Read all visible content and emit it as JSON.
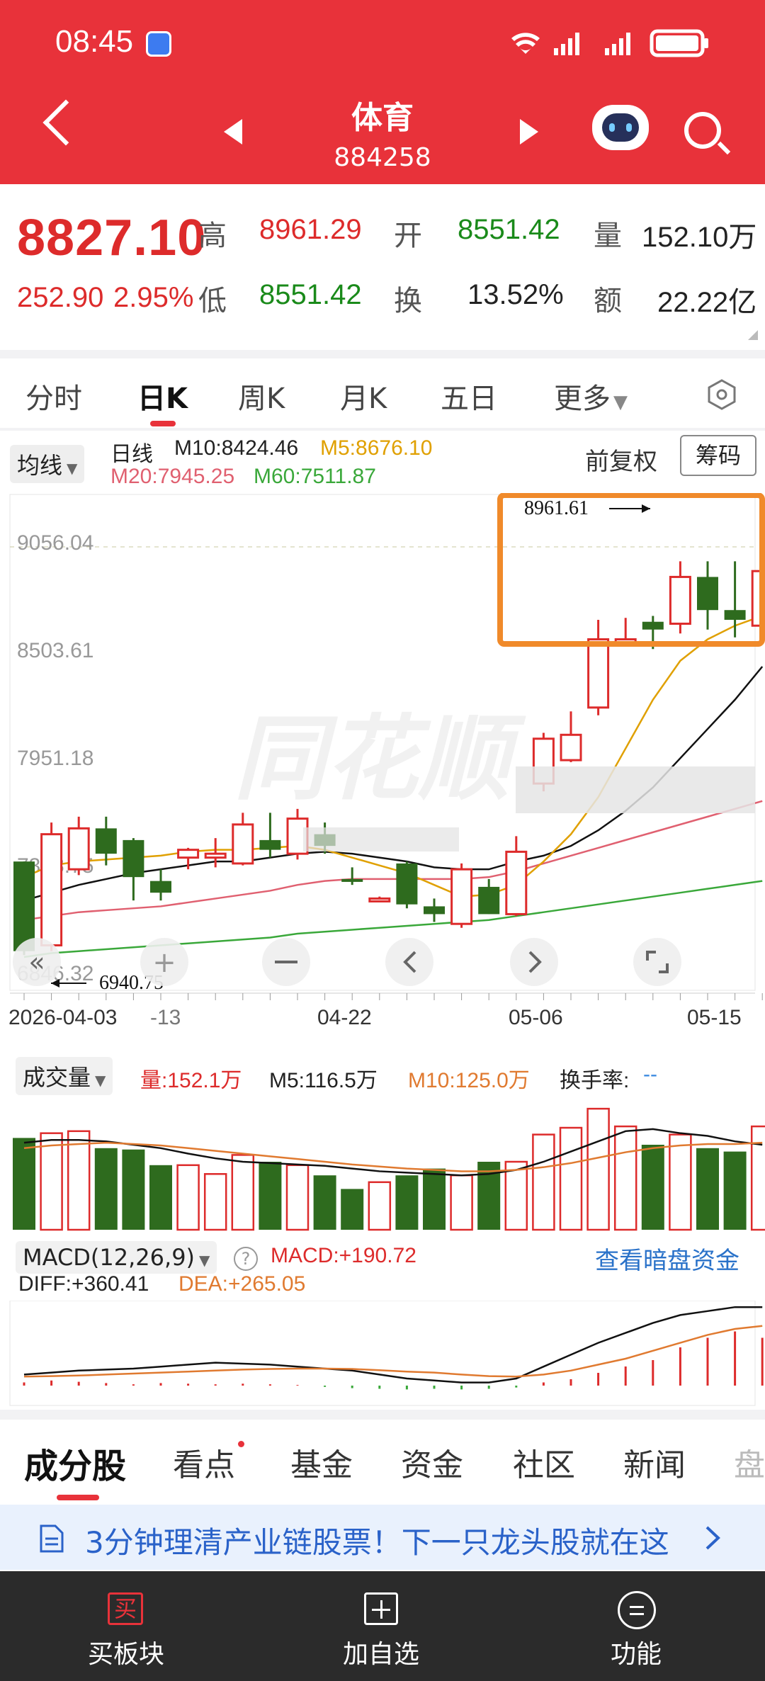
{
  "status_bar": {
    "time": "08:45"
  },
  "header": {
    "title": "体育",
    "code": "884258"
  },
  "quote": {
    "price": "8827.10",
    "change": "252.90",
    "change_pct": "2.95%",
    "high_label": "高",
    "high": "8961.29",
    "open_label": "开",
    "open": "8551.42",
    "volume_label": "量",
    "volume": "152.10万",
    "low_label": "低",
    "low": "8551.42",
    "turnover_label": "换",
    "turnover": "13.52%",
    "amount_label": "额",
    "amount": "22.22亿"
  },
  "period_tabs": [
    "分时",
    "日K",
    "周K",
    "月K",
    "五日",
    "更多"
  ],
  "indicator": {
    "ma_select": "均线",
    "period": "日线",
    "m10": "M10:8424.46",
    "m5": "M5:8676.10",
    "m20": "M20:7945.25",
    "m60": "M60:7511.87",
    "adjust": "前复权",
    "chips": "筹码"
  },
  "kline_axis": {
    "y_labels": [
      "9056.04",
      "8503.61",
      "7951.18",
      "7398.75",
      "6846.32"
    ],
    "x_labels": [
      "2026-04-03",
      "-13",
      "04-22",
      "05-06",
      "05-15"
    ],
    "high_marker": "8961.61",
    "low_marker": "6940.75"
  },
  "volume_panel": {
    "select": "成交量",
    "vol": "量:152.1万",
    "m5": "M5:116.5万",
    "m10": "M10:125.0万",
    "turnover": "换手率:",
    "turnover_val": "--"
  },
  "macd_panel": {
    "select": "MACD(12,26,9)",
    "macd": "MACD:+190.72",
    "link": "查看暗盘资金",
    "diff": "DIFF:+360.41",
    "dea": "DEA:+265.05"
  },
  "bottom_tabs": [
    "成分股",
    "看点",
    "基金",
    "资金",
    "社区",
    "新闻",
    "盘"
  ],
  "banner": {
    "text": "3分钟理清产业链股票！下一只龙头股就在这"
  },
  "nav": {
    "buy": "买板块",
    "buy_icon": "买",
    "add": "加自选",
    "func": "功能"
  },
  "colors": {
    "up": "#dd2b2b",
    "down": "#2e6b1e",
    "brand": "#e8323a",
    "highlight": "#f08a2a"
  },
  "chart_data": {
    "type": "candlestick",
    "y_range": [
      6846.32,
      9056.04
    ],
    "candles": [
      {
        "o": 7420,
        "c": 6960,
        "h": 7420,
        "l": 6940
      },
      {
        "o": 6990,
        "c": 7560,
        "h": 7620,
        "l": 6960
      },
      {
        "o": 7380,
        "c": 7590,
        "h": 7650,
        "l": 7350
      },
      {
        "o": 7590,
        "c": 7460,
        "h": 7650,
        "l": 7400
      },
      {
        "o": 7530,
        "c": 7340,
        "h": 7540,
        "l": 7220
      },
      {
        "o": 7320,
        "c": 7260,
        "h": 7380,
        "l": 7220
      },
      {
        "o": 7440,
        "c": 7480,
        "h": 7490,
        "l": 7380
      },
      {
        "o": 7440,
        "c": 7460,
        "h": 7540,
        "l": 7390
      },
      {
        "o": 7410,
        "c": 7610,
        "h": 7670,
        "l": 7400
      },
      {
        "o": 7530,
        "c": 7480,
        "h": 7670,
        "l": 7440
      },
      {
        "o": 7460,
        "c": 7640,
        "h": 7690,
        "l": 7430
      },
      {
        "o": 7560,
        "c": 7500,
        "h": 7620,
        "l": 7460
      },
      {
        "o": 7330,
        "c": 7320,
        "h": 7390,
        "l": 7300
      },
      {
        "o": 7230,
        "c": 7230,
        "h": 7240,
        "l": 7220
      },
      {
        "o": 7410,
        "c": 7200,
        "h": 7420,
        "l": 7180
      },
      {
        "o": 7190,
        "c": 7150,
        "h": 7230,
        "l": 7110
      },
      {
        "o": 7100,
        "c": 7380,
        "h": 7410,
        "l": 7080
      },
      {
        "o": 7290,
        "c": 7150,
        "h": 7330,
        "l": 7150
      },
      {
        "o": 7150,
        "c": 7470,
        "h": 7550,
        "l": 7140
      },
      {
        "o": 7820,
        "c": 8050,
        "h": 8080,
        "l": 7780
      },
      {
        "o": 7940,
        "c": 8070,
        "h": 8190,
        "l": 7930
      },
      {
        "o": 8210,
        "c": 8560,
        "h": 8660,
        "l": 8170
      },
      {
        "o": 8560,
        "c": 8560,
        "h": 8670,
        "l": 8530
      },
      {
        "o": 8650,
        "c": 8610,
        "h": 8680,
        "l": 8510
      },
      {
        "o": 8640,
        "c": 8880,
        "h": 8960,
        "l": 8590
      },
      {
        "o": 8880,
        "c": 8710,
        "h": 8960,
        "l": 8610
      },
      {
        "o": 8710,
        "c": 8660,
        "h": 8960,
        "l": 8570
      },
      {
        "o": 8630,
        "c": 8910,
        "h": 8960,
        "l": 8630
      }
    ],
    "ma5": [
      7340,
      7400,
      7420,
      7430,
      7440,
      7450,
      7470,
      7480,
      7480,
      7490,
      7500,
      7480,
      7440,
      7400,
      7360,
      7300,
      7240,
      7250,
      7300,
      7420,
      7560,
      7750,
      8000,
      8250,
      8450,
      8560,
      8630,
      8680
    ],
    "ma10": [
      7220,
      7260,
      7300,
      7330,
      7360,
      7380,
      7400,
      7420,
      7420,
      7440,
      7460,
      7470,
      7460,
      7440,
      7420,
      7390,
      7380,
      7380,
      7420,
      7450,
      7500,
      7580,
      7680,
      7800,
      7950,
      8100,
      8250,
      8420
    ],
    "ma20": [
      7120,
      7140,
      7160,
      7170,
      7180,
      7190,
      7210,
      7230,
      7250,
      7270,
      7300,
      7320,
      7330,
      7330,
      7330,
      7330,
      7330,
      7340,
      7370,
      7410,
      7450,
      7490,
      7530,
      7570,
      7610,
      7650,
      7690,
      7730
    ],
    "ma60": [
      6930,
      6950,
      6960,
      6970,
      6980,
      6990,
      7000,
      7010,
      7020,
      7030,
      7050,
      7060,
      7070,
      7080,
      7090,
      7100,
      7110,
      7120,
      7140,
      7160,
      7180,
      7200,
      7220,
      7240,
      7260,
      7280,
      7300,
      7320
    ],
    "volume": [
      135,
      142,
      145,
      120,
      118,
      95,
      95,
      82,
      110,
      100,
      95,
      80,
      60,
      70,
      80,
      90,
      80,
      100,
      100,
      140,
      150,
      178,
      152,
      125,
      140,
      120,
      115,
      152
    ],
    "vol_m5": [
      128,
      132,
      132,
      130,
      125,
      120,
      112,
      105,
      100,
      98,
      96,
      94,
      90,
      86,
      84,
      82,
      80,
      82,
      88,
      100,
      115,
      130,
      145,
      148,
      142,
      138,
      130,
      125
    ],
    "vol_m10": [
      120,
      124,
      126,
      128,
      126,
      124,
      120,
      116,
      112,
      108,
      104,
      100,
      96,
      93,
      90,
      88,
      86,
      86,
      88,
      92,
      98,
      106,
      114,
      120,
      124,
      126,
      126,
      128
    ],
    "macd_hist": [
      5,
      8,
      6,
      4,
      2,
      4,
      3,
      2,
      3,
      2,
      1,
      -2,
      -4,
      -5,
      -6,
      -5,
      -6,
      -5,
      -3,
      5,
      10,
      20,
      30,
      40,
      60,
      75,
      85,
      75
    ],
    "diff": [
      20,
      30,
      40,
      45,
      50,
      60,
      70,
      80,
      75,
      70,
      60,
      50,
      40,
      20,
      0,
      -10,
      -20,
      -20,
      0,
      60,
      120,
      180,
      230,
      280,
      320,
      340,
      360,
      360
    ],
    "dea": [
      10,
      12,
      15,
      20,
      25,
      30,
      35,
      40,
      45,
      48,
      50,
      50,
      48,
      42,
      35,
      30,
      20,
      12,
      10,
      20,
      40,
      70,
      100,
      140,
      180,
      220,
      250,
      265
    ]
  }
}
